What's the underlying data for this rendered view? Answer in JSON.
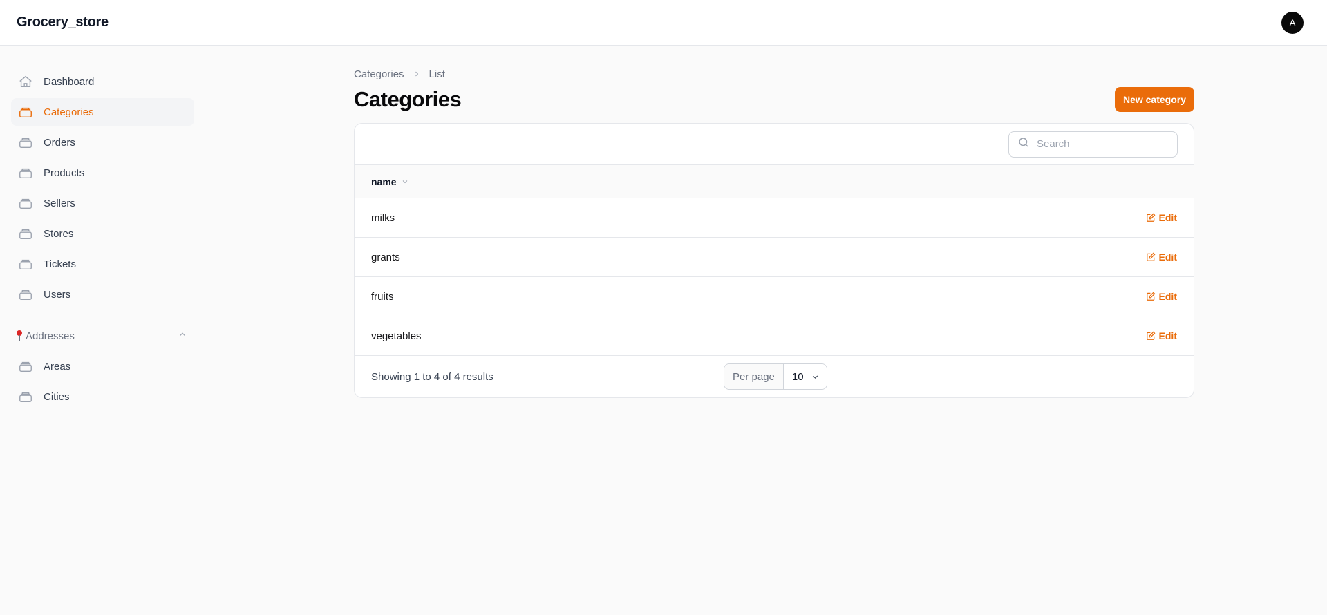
{
  "app": {
    "brand": "Grocery_store",
    "avatar_initial": "A"
  },
  "colors": {
    "accent": "#ea6c0a",
    "active_bg": "#f3f4f6",
    "background": "#fafafa"
  },
  "sidebar": {
    "items": [
      {
        "label": "Dashboard",
        "icon": "home-icon",
        "active": false
      },
      {
        "label": "Categories",
        "icon": "collection-icon",
        "active": true
      },
      {
        "label": "Orders",
        "icon": "collection-icon",
        "active": false
      },
      {
        "label": "Products",
        "icon": "collection-icon",
        "active": false
      },
      {
        "label": "Sellers",
        "icon": "collection-icon",
        "active": false
      },
      {
        "label": "Stores",
        "icon": "collection-icon",
        "active": false
      },
      {
        "label": "Tickets",
        "icon": "collection-icon",
        "active": false
      },
      {
        "label": "Users",
        "icon": "collection-icon",
        "active": false
      }
    ],
    "group": {
      "label": "Addresses",
      "icon": "pushpin-icon",
      "expanded": true,
      "items": [
        {
          "label": "Areas",
          "icon": "collection-icon"
        },
        {
          "label": "Cities",
          "icon": "collection-icon"
        }
      ]
    }
  },
  "breadcrumb": [
    "Categories",
    "List"
  ],
  "page": {
    "title": "Categories",
    "new_button": "New category"
  },
  "table": {
    "search_placeholder": "Search",
    "column_header": "name",
    "rows": [
      {
        "name": "milks",
        "action": "Edit"
      },
      {
        "name": "grants",
        "action": "Edit"
      },
      {
        "name": "fruits",
        "action": "Edit"
      },
      {
        "name": "vegetables",
        "action": "Edit"
      }
    ],
    "showing_text": "Showing 1 to 4 of 4 results",
    "per_page_label": "Per page",
    "per_page_value": "10"
  }
}
